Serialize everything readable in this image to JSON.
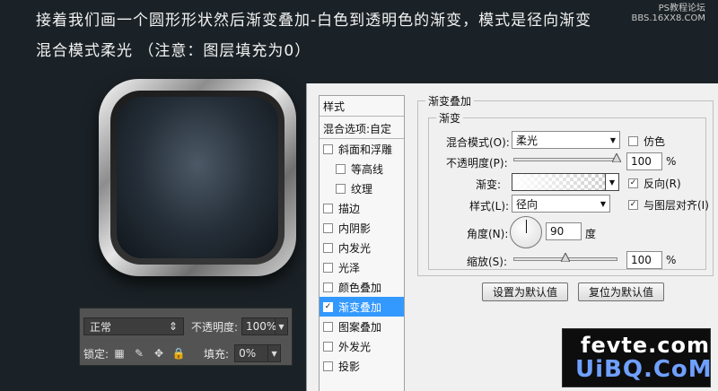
{
  "instructions": {
    "line1": "接着我们画一个圆形形状然后渐变叠加-白色到透明色的渐变，模式是径向渐变",
    "line2": "混合模式柔光  （注意：图层填充为0）"
  },
  "watermark_top": {
    "line1": "PS教程论坛",
    "line2": "BBS.16XX8.COM"
  },
  "layers_panel": {
    "blend_mode": "正常",
    "opacity_label": "不透明度:",
    "opacity_value": "100%",
    "lock_label": "锁定:",
    "fill_label": "填充:",
    "fill_value": "0%",
    "icons": [
      "transparency-lock-icon",
      "brush-lock-icon",
      "move-lock-icon",
      "padlock-icon"
    ]
  },
  "style_list": {
    "header": "样式",
    "blend_options": "混合选项:自定",
    "items": [
      {
        "label": "斜面和浮雕",
        "checked": false,
        "sub": false
      },
      {
        "label": "等高线",
        "checked": false,
        "sub": true
      },
      {
        "label": "纹理",
        "checked": false,
        "sub": true
      },
      {
        "label": "描边",
        "checked": false,
        "sub": false
      },
      {
        "label": "内阴影",
        "checked": false,
        "sub": false
      },
      {
        "label": "内发光",
        "checked": false,
        "sub": false
      },
      {
        "label": "光泽",
        "checked": false,
        "sub": false
      },
      {
        "label": "颜色叠加",
        "checked": false,
        "sub": false
      },
      {
        "label": "渐变叠加",
        "checked": true,
        "sub": false,
        "selected": true
      },
      {
        "label": "图案叠加",
        "checked": false,
        "sub": false
      },
      {
        "label": "外发光",
        "checked": false,
        "sub": false
      },
      {
        "label": "投影",
        "checked": false,
        "sub": false
      }
    ]
  },
  "gradient_overlay": {
    "title": "渐变叠加",
    "group": "渐变",
    "blend_mode_label": "混合模式(O):",
    "blend_mode_value": "柔光",
    "dither_label": "仿色",
    "dither_checked": false,
    "opacity_label": "不透明度(P):",
    "opacity_value": "100",
    "opacity_level": 1.0,
    "unit_percent": "%",
    "gradient_label": "渐变:",
    "reverse_label": "反向(R)",
    "reverse_checked": true,
    "style_label": "样式(L):",
    "style_value": "径向",
    "align_label": "与图层对齐(I)",
    "align_checked": true,
    "angle_label": "角度(N):",
    "angle_value": "90",
    "angle_unit": "度",
    "scale_label": "缩放(S):",
    "scale_value": "100",
    "scale_level": 0.5,
    "btn_default": "设置为默认值",
    "btn_reset": "复位为默认值"
  },
  "watermark_bottom": {
    "line1": "fevte.com",
    "line2": "UiBQ.CoM"
  }
}
